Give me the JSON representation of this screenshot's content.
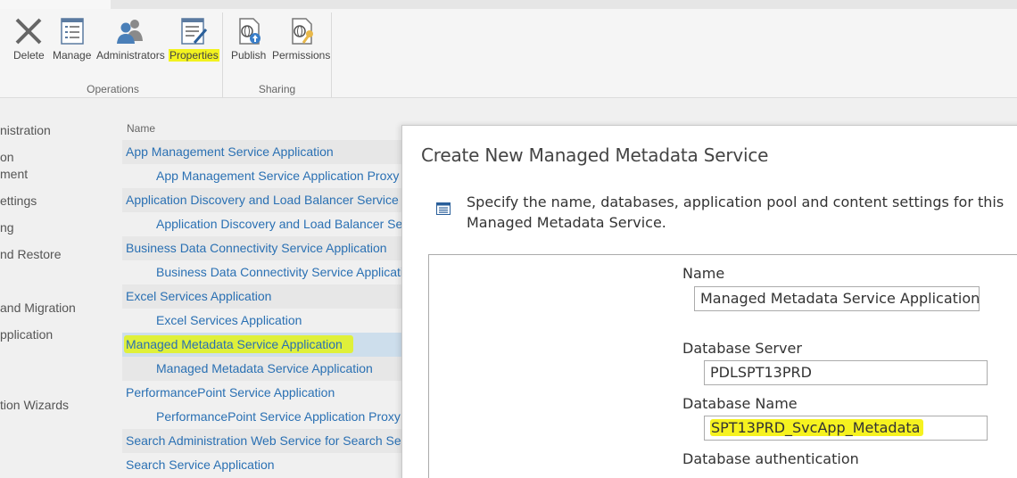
{
  "ribbon": {
    "groups": {
      "operations": "Operations",
      "sharing": "Sharing"
    },
    "buttons": {
      "delete": "Delete",
      "manage": "Manage",
      "administrators": "Administrators",
      "properties": "Properties",
      "publish": "Publish",
      "permissions": "Permissions"
    }
  },
  "leftnav": {
    "items": [
      "nistration",
      "on",
      "ment",
      "ettings",
      "ng",
      "nd Restore",
      "and Migration",
      "pplication",
      "tion Wizards"
    ]
  },
  "list": {
    "column_header": "Name",
    "rows": [
      "App Management Service Application",
      "App Management Service Application Proxy",
      "Application Discovery and Load Balancer Service Application",
      "Application Discovery and Load Balancer Service Application Proxy",
      "Business Data Connectivity Service Application",
      "Business Data Connectivity Service Application Proxy",
      "Excel Services Application",
      "Excel Services Application",
      "Managed Metadata Service Application",
      "Managed Metadata Service Application",
      "PerformancePoint Service Application",
      "PerformancePoint Service Application Proxy",
      "Search Administration Web Service for Search Service Application",
      "Search Service Application"
    ]
  },
  "dialog": {
    "title": "Create New Managed Metadata Service",
    "description": "Specify the name, databases, application pool and content settings for this Managed Metadata Service.",
    "name_label": "Name",
    "name_value": "Managed Metadata Service Application",
    "db_server_label": "Database Server",
    "db_server_value": "PDLSPT13PRD",
    "db_name_label": "Database Name",
    "db_name_value": "SPT13PRD_SvcApp_Metadata",
    "db_auth_label": "Database authentication"
  },
  "colors": {
    "link": "#2a70b3",
    "highlight": "#f2f21f",
    "selected_row": "#cddeec"
  }
}
